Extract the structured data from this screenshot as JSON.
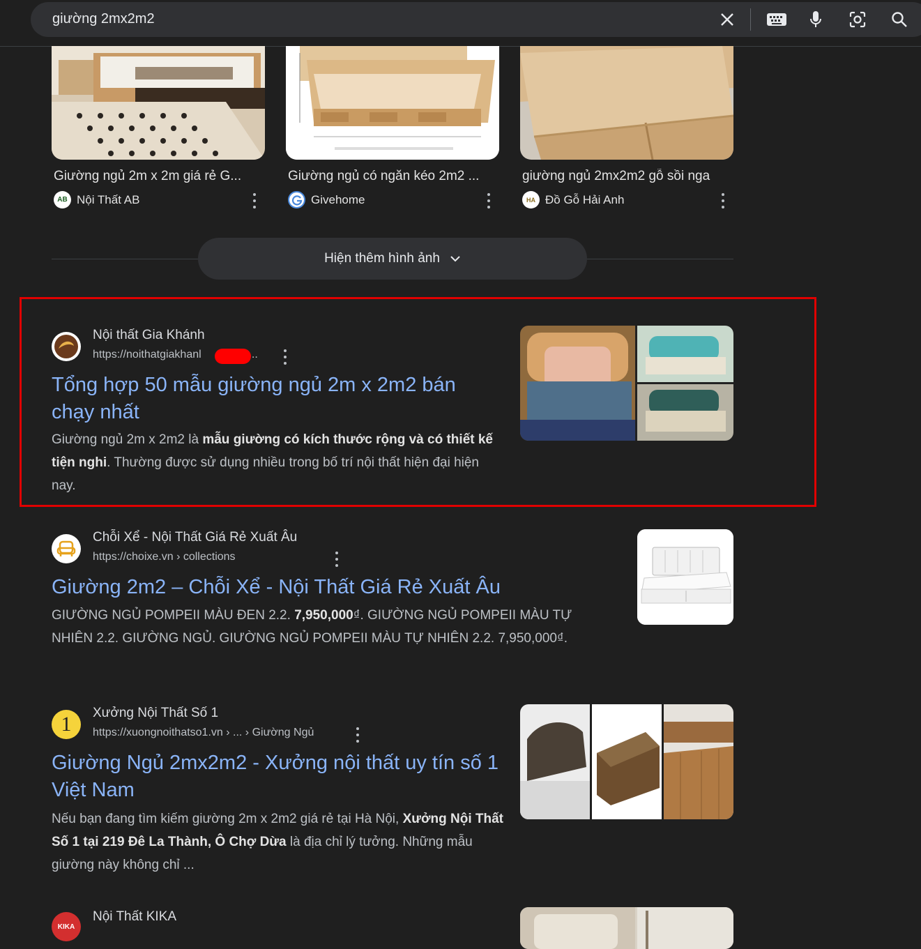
{
  "search": {
    "query": "giường 2mx2m2",
    "icons": [
      "clear-icon",
      "keyboard-icon",
      "mic-icon",
      "lens-icon",
      "search-icon"
    ]
  },
  "image_results": [
    {
      "caption": "Giường ngủ 2m x 2m giá rẻ G...",
      "source": "Nội Thất AB",
      "favicon": "AB"
    },
    {
      "caption": "Giường ngủ có ngăn kéo 2m2 ...",
      "source": "Givehome",
      "favicon": "G"
    },
    {
      "caption": "giường ngủ 2mx2m2 gỗ sồi nga",
      "source": "Đồ Gỗ Hải Anh",
      "favicon": "HA"
    }
  ],
  "more_images": {
    "label": "Hiện thêm hình ảnh"
  },
  "results": [
    {
      "site_name": "Nội thất Gia Khánh",
      "url": "https://noithatgiakhanl",
      "url_tail": "› ...",
      "title": "Tổng hợp 50 mẫu giường ngủ 2m x 2m2 bán chạy nhất",
      "snippet": [
        "Giường ngủ 2m x 2m2 là ",
        "mẫu giường có kích thước rộng và có thiết kế tiện nghi",
        ". Thường được sử dụng nhiều trong bố trí nội thất hiện đại hiện nay."
      ]
    },
    {
      "site_name": "Chỗi Xể - Nội Thất Giá Rẻ Xuất Âu",
      "url": "https://choixe.vn › collections",
      "title": "Giường 2m2 – Chỗi Xể - Nội Thất Giá Rẻ Xuất Âu",
      "snippet": [
        "GIƯỜNG NGỦ POMPEII MÀU ĐEN 2.2. ",
        "7,950,000",
        "₫. GIƯỜNG NGỦ POMPEII MÀU TỰ NHIÊN 2.2. GIƯỜNG NGỦ. GIƯỜNG NGỦ POMPEII MÀU TỰ NHIÊN 2.2. 7,950,000₫."
      ]
    },
    {
      "site_name": "Xưởng Nội Thất Số 1",
      "url": "https://xuongnoithatso1.vn › ... › Giường Ngủ",
      "title": "Giường Ngủ 2mx2m2 - Xưởng nội thất uy tín số 1 Việt Nam",
      "snippet": [
        "Nếu bạn đang tìm kiếm giường 2m x 2m2 giá rẻ tại Hà Nội, ",
        "Xưởng Nội Thất Số 1 tại 219 Đê La Thành, Ô Chợ Dừa",
        " là địa chỉ lý tưởng. Những mẫu giường này không chỉ ..."
      ],
      "favicon": "1"
    },
    {
      "site_name": "Nội Thất KIKA",
      "favicon": "KIKA"
    }
  ],
  "colors": {
    "background": "#1f1f1f",
    "link": "#8ab4f8",
    "highlight": "#e00000"
  }
}
